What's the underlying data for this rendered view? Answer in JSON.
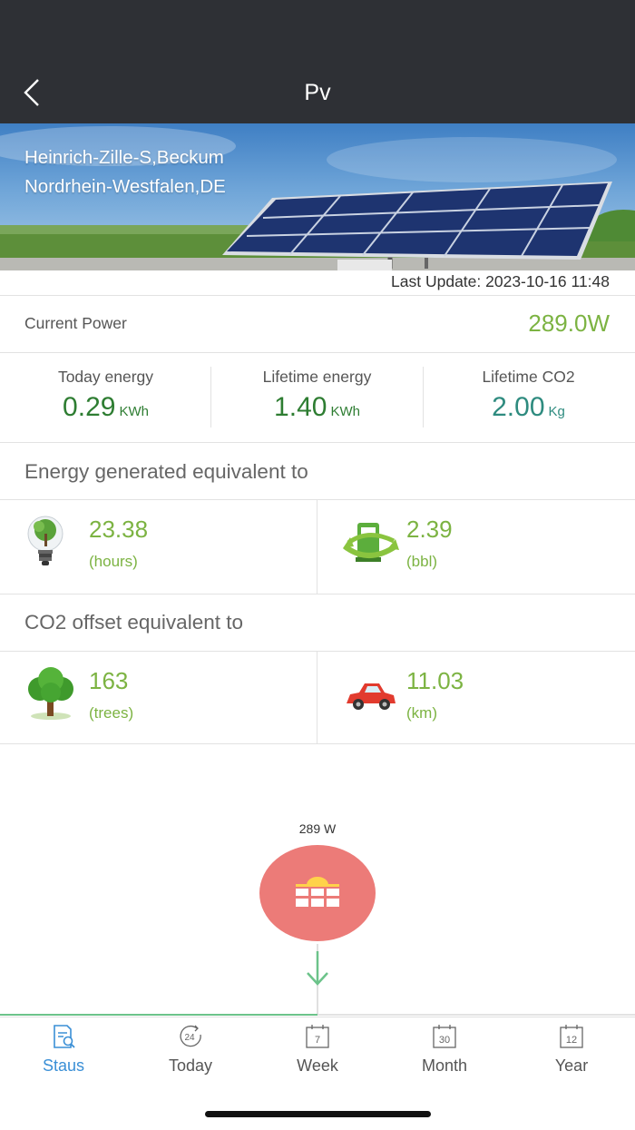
{
  "header": {
    "title": "Pv"
  },
  "site": {
    "address_line1": "Heinrich-Zille-S,Beckum",
    "address_line2": "Nordrhein-Westfalen,DE",
    "last_update": "Last Update: 2023-10-16 11:48"
  },
  "current_power": {
    "label": "Current Power",
    "value": "289.0W"
  },
  "stats": [
    {
      "label": "Today energy",
      "value": "0.29",
      "unit": "KWh",
      "color": "#2e7d32"
    },
    {
      "label": "Lifetime energy",
      "value": "1.40",
      "unit": "KWh",
      "color": "#2e7d32"
    },
    {
      "label": "Lifetime CO2",
      "value": "2.00",
      "unit": "Kg",
      "color": "#2e8b7f"
    }
  ],
  "energy_equivalent": {
    "title": "Energy generated equivalent to",
    "items": [
      {
        "icon": "light-bulb-icon",
        "value": "23.38",
        "unit": "(hours)"
      },
      {
        "icon": "fuel-pump-icon",
        "value": "2.39",
        "unit": "(bbl)"
      }
    ]
  },
  "co2_equivalent": {
    "title": "CO2 offset equivalent to",
    "items": [
      {
        "icon": "tree-icon",
        "value": "163",
        "unit": "(trees)"
      },
      {
        "icon": "car-icon",
        "value": "11.03",
        "unit": "(km)"
      }
    ]
  },
  "flow": {
    "pv_power": "289 W",
    "node_color": "#ec7b78",
    "arrow_color": "#6cc38a"
  },
  "tabs": [
    {
      "label": "Staus",
      "icon": "status-report-icon",
      "active": true
    },
    {
      "label": "Today",
      "icon": "24h-icon",
      "active": false
    },
    {
      "label": "Week",
      "icon": "calendar-7-icon",
      "active": false
    },
    {
      "label": "Month",
      "icon": "calendar-30-icon",
      "active": false
    },
    {
      "label": "Year",
      "icon": "calendar-12-icon",
      "active": false
    }
  ],
  "colors": {
    "accent_green": "#7cb342",
    "tab_active": "#3a8fd6",
    "header_bg": "#2e3035"
  }
}
